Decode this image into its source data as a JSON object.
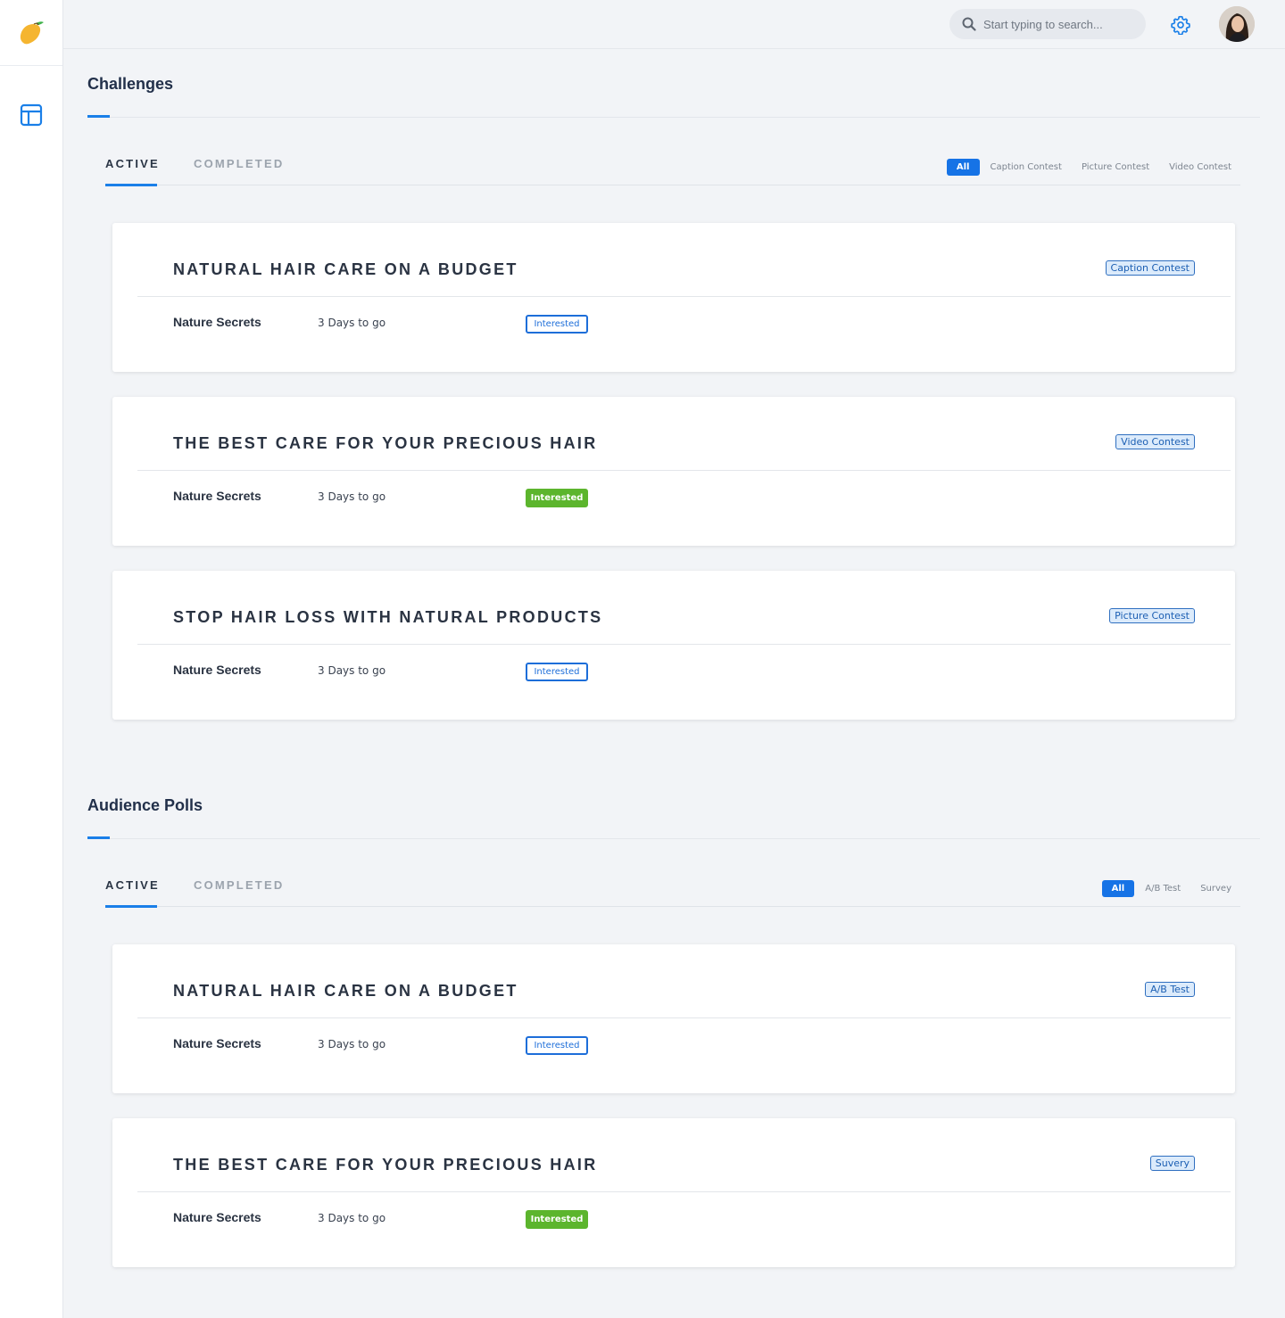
{
  "search": {
    "placeholder": "Start typing to search..."
  },
  "icons": {
    "logo": "mango-logo",
    "nav": "layout-icon",
    "search": "search-icon",
    "settings": "gear-icon"
  },
  "colors": {
    "accent": "#1a7fe8",
    "success": "#5cb52d",
    "background": "#f2f4f7"
  },
  "sections": [
    {
      "title": "Challenges",
      "tabs": [
        "ACTIVE",
        "COMPLETED"
      ],
      "filters": [
        "All",
        "Caption Contest",
        "Picture Contest",
        "Video Contest"
      ],
      "cards": [
        {
          "title": "NATURAL HAIR CARE ON A BUDGET",
          "badge": "Caption Contest",
          "brand": "Nature Secrets",
          "days": "3 Days to go",
          "status": "Interested",
          "interested": false
        },
        {
          "title": "THE BEST CARE FOR YOUR PRECIOUS HAIR",
          "badge": "Video Contest",
          "brand": "Nature Secrets",
          "days": "3 Days to go",
          "status": "Interested",
          "interested": true
        },
        {
          "title": "STOP HAIR LOSS WITH NATURAL PRODUCTS",
          "badge": "Picture Contest",
          "brand": "Nature Secrets",
          "days": "3 Days to go",
          "status": "Interested",
          "interested": false
        }
      ]
    },
    {
      "title": "Audience Polls",
      "tabs": [
        "ACTIVE",
        "COMPLETED"
      ],
      "filters": [
        "All",
        "A/B Test",
        "Survey"
      ],
      "cards": [
        {
          "title": "NATURAL HAIR CARE ON A BUDGET",
          "badge": "A/B Test",
          "brand": "Nature Secrets",
          "days": "3 Days to go",
          "status": "Interested",
          "interested": false
        },
        {
          "title": "THE BEST CARE FOR YOUR PRECIOUS HAIR",
          "badge": "Suvery",
          "brand": "Nature Secrets",
          "days": "3 Days to go",
          "status": "Interested",
          "interested": true
        }
      ]
    }
  ]
}
